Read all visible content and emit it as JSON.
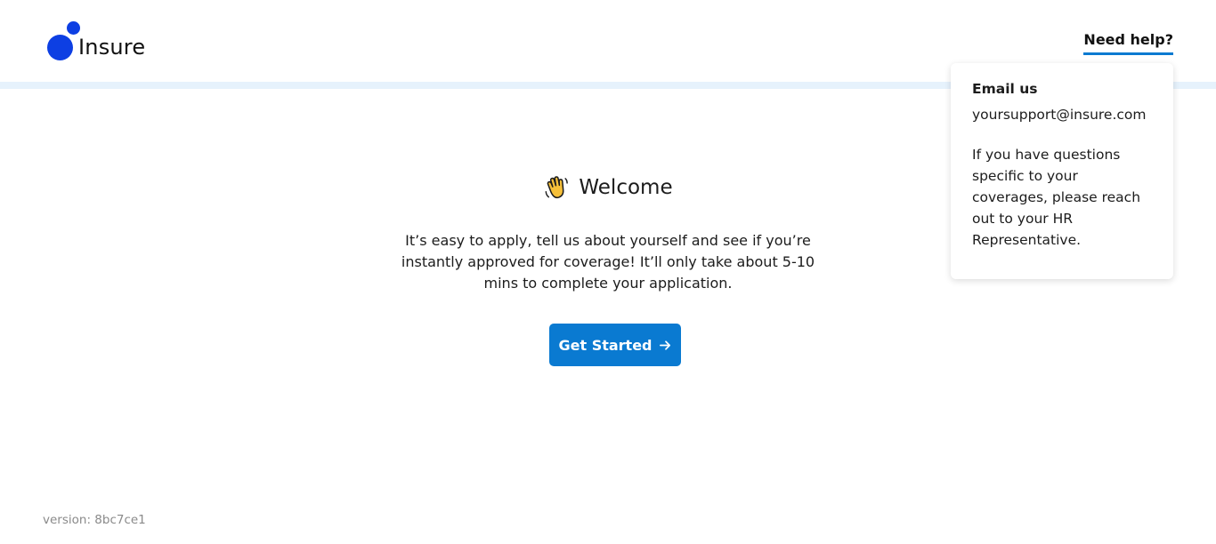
{
  "brand": {
    "name": "Insure",
    "color": "#0d3fe3"
  },
  "header": {
    "help_label": "Need help?",
    "accent": "#0a7ad1"
  },
  "help_popover": {
    "title": "Email us",
    "email": "yoursupport@insure.com",
    "note": "If you have questions specific to your coverages, please reach out to your HR Representative."
  },
  "main": {
    "icon": "waving-hand-icon",
    "title": "Welcome",
    "intro": "It’s easy to apply, tell us about yourself and see if you’re instantly approved for coverage! It’ll only take about 5-10 mins to complete your application.",
    "cta_label": "Get Started",
    "cta_icon": "arrow-right-icon"
  },
  "footer": {
    "version": "version: 8bc7ce1"
  }
}
